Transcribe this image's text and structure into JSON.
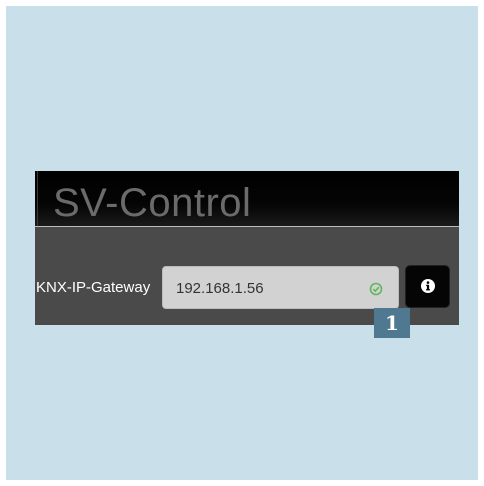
{
  "app": {
    "title": "SV-Control"
  },
  "gateway": {
    "label": "KNX-IP-Gateway",
    "value": "192.168.1.56",
    "status_icon": "check-circle-icon",
    "status_color": "#5cb85c"
  },
  "info_button": {
    "icon": "info-icon"
  },
  "callout": {
    "number": "1",
    "color": "#4f7990"
  },
  "colors": {
    "background": "#c9dfe9",
    "panel": "#4a4a4a",
    "titlebar": "#000000"
  }
}
